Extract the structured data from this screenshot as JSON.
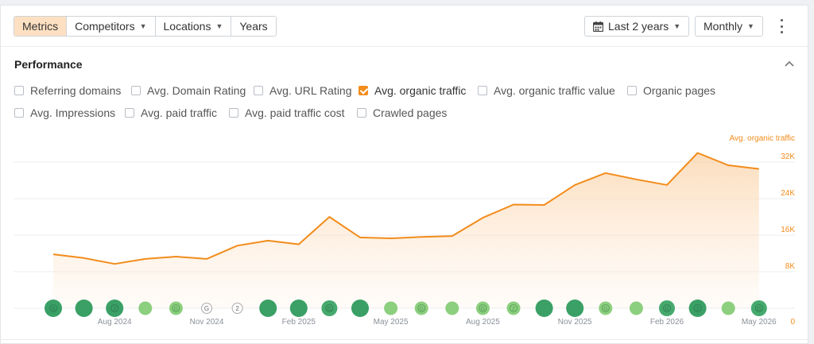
{
  "toolbar": {
    "tabs": [
      {
        "label": "Metrics",
        "active": true,
        "has_dropdown": false
      },
      {
        "label": "Competitors",
        "active": false,
        "has_dropdown": true
      },
      {
        "label": "Locations",
        "active": false,
        "has_dropdown": true
      },
      {
        "label": "Years",
        "active": false,
        "has_dropdown": false
      }
    ],
    "date_range": {
      "label": "Last 2 years",
      "icon": "calendar-icon"
    },
    "granularity": {
      "label": "Monthly"
    },
    "more_icon": "kebab-icon"
  },
  "performance": {
    "title": "Performance",
    "collapse_icon": "chevron-up-icon",
    "checkboxes": [
      {
        "label": "Referring domains",
        "checked": false
      },
      {
        "label": "Avg. Domain Rating",
        "checked": false
      },
      {
        "label": "Avg. URL Rating",
        "checked": false
      },
      {
        "label": "Avg. organic traffic",
        "checked": true
      },
      {
        "label": "Avg. organic traffic value",
        "checked": false
      },
      {
        "label": "Organic pages",
        "checked": false
      },
      {
        "label": "Avg. Impressions",
        "checked": false
      },
      {
        "label": "Avg. paid traffic",
        "checked": false
      },
      {
        "label": "Avg. paid traffic cost",
        "checked": false
      },
      {
        "label": "Crawled pages",
        "checked": false
      }
    ]
  },
  "colors": {
    "accent": "#f28c1c",
    "active_tab": "#fde0c2",
    "marker_dark": "#3aa065",
    "marker_light": "#8ccf7e"
  },
  "chart_data": {
    "type": "area",
    "series": [
      {
        "name": "Avg. organic traffic",
        "values": [
          11800,
          11000,
          9700,
          10800,
          11300,
          10800,
          13700,
          14800,
          14000,
          20000,
          15500,
          15300,
          15600,
          15800,
          19800,
          22700,
          22600,
          27000,
          29600,
          28200,
          27000,
          34000,
          31300,
          30500
        ]
      }
    ],
    "yticks": [
      "32K",
      "24K",
      "16K",
      "8K",
      "0"
    ],
    "ytick_values": [
      32000,
      24000,
      16000,
      8000,
      0
    ],
    "ylim": [
      0,
      32000
    ],
    "xticks": [
      "Aug 2024",
      "Nov 2024",
      "Feb 2025",
      "May 2025",
      "Aug 2025",
      "Nov 2025",
      "Feb 2026",
      "May 2026"
    ],
    "xtick_indices": [
      2,
      5,
      8,
      11,
      14,
      17,
      20,
      23
    ],
    "series_label": "Avg. organic traffic",
    "grid": true,
    "markers": [
      {
        "kind": "dark-big",
        "label": "G"
      },
      {
        "kind": "dark-big",
        "label": ""
      },
      {
        "kind": "dark-big",
        "label": "2"
      },
      {
        "kind": "light",
        "label": ""
      },
      {
        "kind": "light",
        "label": "G"
      },
      {
        "kind": "outline",
        "label": "G"
      },
      {
        "kind": "outline",
        "label": "2"
      },
      {
        "kind": "dark-big",
        "label": ""
      },
      {
        "kind": "dark-big",
        "label": ""
      },
      {
        "kind": "dark-mid",
        "label": "G"
      },
      {
        "kind": "dark-big",
        "label": ""
      },
      {
        "kind": "light",
        "label": ""
      },
      {
        "kind": "light",
        "label": "G"
      },
      {
        "kind": "light",
        "label": ""
      },
      {
        "kind": "light",
        "label": "G"
      },
      {
        "kind": "light",
        "label": "2"
      },
      {
        "kind": "dark-big",
        "label": ""
      },
      {
        "kind": "dark-big",
        "label": ""
      },
      {
        "kind": "light",
        "label": "G"
      },
      {
        "kind": "light",
        "label": ""
      },
      {
        "kind": "dark-mid",
        "label": "G"
      },
      {
        "kind": "dark-big",
        "label": "2"
      },
      {
        "kind": "light",
        "label": ""
      },
      {
        "kind": "dark-mid",
        "label": "G"
      }
    ]
  }
}
